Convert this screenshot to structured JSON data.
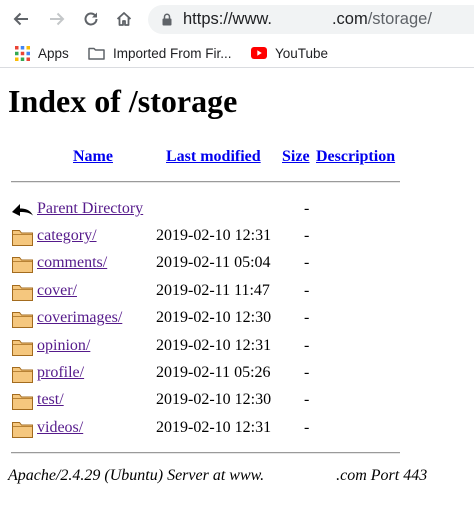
{
  "browser": {
    "url_scheme": "https://www.",
    "url_domain_suffix": ".com",
    "url_path": "/storage/",
    "bookmarks": [
      {
        "label": "Apps",
        "icon": "apps-grid-icon"
      },
      {
        "label": "Imported From Fir...",
        "icon": "folder-icon"
      },
      {
        "label": "YouTube",
        "icon": "youtube-icon"
      }
    ]
  },
  "page": {
    "title": "Index of /storage",
    "columns": {
      "name": "Name",
      "last_modified": "Last modified",
      "size": "Size",
      "description": "Description"
    },
    "parent": {
      "label": "Parent Directory",
      "size": "-"
    },
    "entries": [
      {
        "name": "category/",
        "modified": "2019-02-10 12:31",
        "size": "-"
      },
      {
        "name": "comments/",
        "modified": "2019-02-11 05:04",
        "size": "-"
      },
      {
        "name": "cover/",
        "modified": "2019-02-11 11:47",
        "size": "-"
      },
      {
        "name": "coverimages/",
        "modified": "2019-02-10 12:30",
        "size": "-"
      },
      {
        "name": "opinion/",
        "modified": "2019-02-10 12:31",
        "size": "-"
      },
      {
        "name": "profile/",
        "modified": "2019-02-11 05:26",
        "size": "-"
      },
      {
        "name": "test/",
        "modified": "2019-02-10 12:30",
        "size": "-"
      },
      {
        "name": "videos/",
        "modified": "2019-02-10 12:31",
        "size": "-"
      }
    ],
    "address": "Apache/2.4.29 (Ubuntu) Server at www.                  .com Port 443"
  },
  "colors": {
    "link_unvisited": "#0000ee",
    "link_visited": "#551a8b",
    "omnibox_bg": "#f1f3f4",
    "folder_fill": "#f5c77e",
    "folder_stroke": "#a36b1e"
  }
}
